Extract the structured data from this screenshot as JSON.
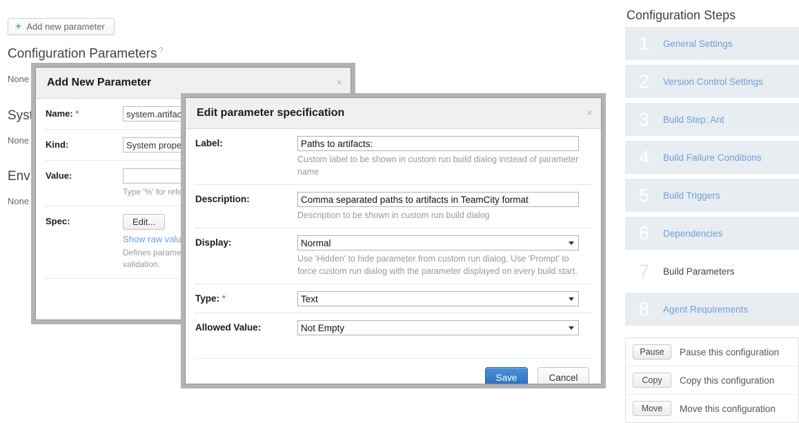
{
  "background": {
    "add_button": {
      "label": "Add new parameter",
      "icon": "plus-icon"
    },
    "headings": [
      {
        "text": "Configuration Parameters",
        "help": "?"
      },
      {
        "text": "System Properties"
      },
      {
        "text": "Environment Variables"
      }
    ],
    "none_texts": [
      "None of",
      "None of",
      "None of"
    ]
  },
  "add_parameter_dialog": {
    "title": "Add New Parameter",
    "close": "×",
    "rows": [
      {
        "label": "Name:",
        "required": "*",
        "value": "system.artifact."
      },
      {
        "label": "Kind:",
        "required": "",
        "value": "System propert"
      },
      {
        "label": "Value:",
        "required": "",
        "value": "",
        "hint": "Type '%' for refere"
      },
      {
        "label": "Spec:",
        "required": "",
        "button": "Edit...",
        "link": "Show raw value",
        "hint": "Defines paramet\nvalidation."
      }
    ]
  },
  "edit_spec_dialog": {
    "title": "Edit parameter specification",
    "close": "×",
    "fields": [
      {
        "label": "Label:",
        "required": "",
        "control": "text",
        "value": "Paths to artifacts:",
        "hint": "Custom label to be shown in custom run build dialog instead of parameter name"
      },
      {
        "label": "Description:",
        "required": "",
        "control": "text",
        "value": "Comma separated paths to artifacts in TeamCity format",
        "hint": "Description to be shown in custom run build dialog"
      },
      {
        "label": "Display:",
        "required": "",
        "control": "select",
        "value": "Normal",
        "hint": "Use 'Hidden' to hide parameter from custom run dialog. Use 'Prompt' to force custom run dialog with the parameter displayed on every build start."
      },
      {
        "label": "Type:",
        "required": "*",
        "control": "select",
        "value": "Text",
        "hint": ""
      },
      {
        "label": "Allowed Value:",
        "required": "",
        "control": "select",
        "value": "Not Empty",
        "hint": ""
      }
    ],
    "save_label": "Save",
    "cancel_label": "Cancel"
  },
  "sidebar": {
    "title": "Configuration Steps",
    "steps": [
      {
        "num": "1",
        "label": "General Settings",
        "current": false
      },
      {
        "num": "2",
        "label": "Version Control Settings",
        "current": false
      },
      {
        "num": "3",
        "label": "Build Step: Ant",
        "current": false
      },
      {
        "num": "4",
        "label": "Build Failure Conditions",
        "current": false
      },
      {
        "num": "5",
        "label": "Build Triggers",
        "current": false
      },
      {
        "num": "6",
        "label": "Dependencies",
        "current": false
      },
      {
        "num": "7",
        "label": "Build Parameters",
        "current": true
      },
      {
        "num": "8",
        "label": "Agent Requirements",
        "current": false
      }
    ],
    "actions": [
      {
        "button": "Pause",
        "text": "Pause this configuration"
      },
      {
        "button": "Copy",
        "text": "Copy this configuration"
      },
      {
        "button": "Move",
        "text": "Move this configuration"
      }
    ]
  },
  "colors": {
    "link": "#6f9fd4",
    "primary": "#2a6fc0",
    "step_bg": "#e8edf2",
    "dialog_frame": "#b3b3b3",
    "required": "#e8735a",
    "plus": "#6cb96c"
  }
}
